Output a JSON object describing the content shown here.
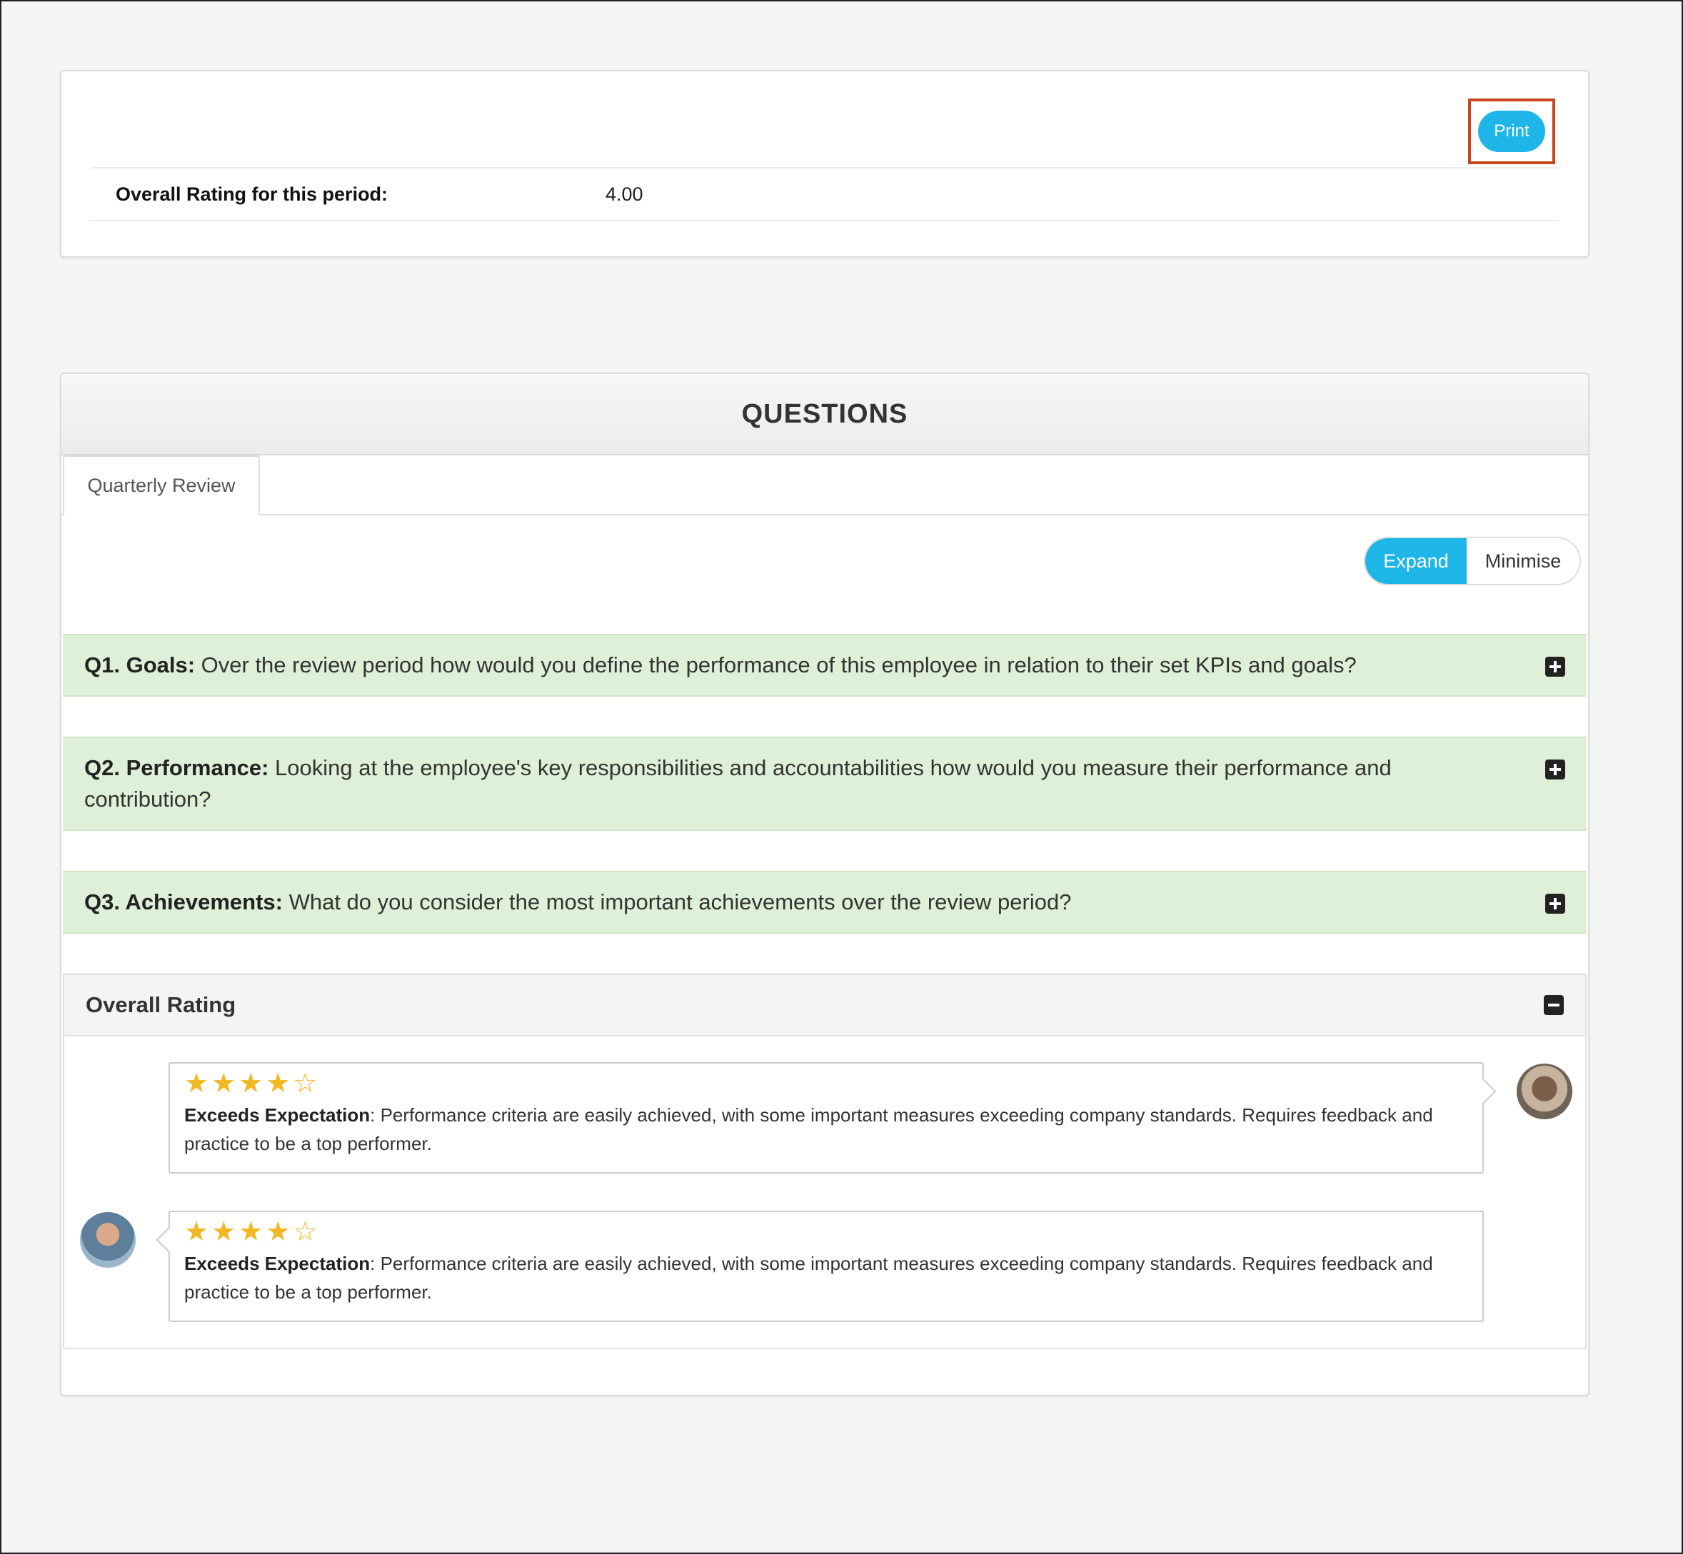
{
  "summary": {
    "print_label": "Print",
    "overall_label": "Overall Rating for this period:",
    "overall_value": "4.00"
  },
  "questions": {
    "title": "QUESTIONS",
    "tab_label": "Quarterly Review",
    "expand_label": "Expand",
    "minimise_label": "Minimise",
    "items": [
      {
        "label": "Q1. Goals:",
        "text": " Over the review period how would you define the performance of this employee in relation to their set KPIs and goals?"
      },
      {
        "label": "Q2. Performance:",
        "text": " Looking at the employee's key responsibilities and accountabilities how would you measure their performance and contribution?"
      },
      {
        "label": "Q3. Achievements:",
        "text": " What do you consider the most important achievements over the review period?"
      }
    ],
    "overall_rating": {
      "title": "Overall Rating",
      "responses": [
        {
          "stars": 4,
          "max_stars": 5,
          "label": "Exceeds Expectation",
          "text": ": Performance criteria are easily achieved, with some important measures exceeding company standards. Requires feedback and practice to be a top performer."
        },
        {
          "stars": 4,
          "max_stars": 5,
          "label": "Exceeds Expectation",
          "text": ": Performance criteria are easily achieved, with some important measures exceeding company standards. Requires feedback and practice to be a top performer."
        }
      ]
    }
  },
  "colors": {
    "accent": "#1eb6e8",
    "question_bg": "#dff0d8",
    "star": "#f2b824",
    "highlight_border": "#c9431f"
  },
  "icons": {
    "expand_question": "plus-square-icon",
    "collapse_section": "minus-square-icon",
    "star_filled": "star-filled-icon",
    "star_empty": "star-empty-icon"
  }
}
